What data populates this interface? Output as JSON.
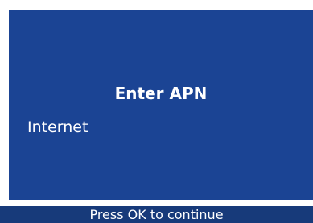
{
  "screen": {
    "title": "Enter APN",
    "field_value": "Internet",
    "footer_hint": "Press OK to continue"
  },
  "colors": {
    "panel_background": "#1b4494",
    "footer_background": "#173a7a",
    "text": "#ffffff"
  }
}
